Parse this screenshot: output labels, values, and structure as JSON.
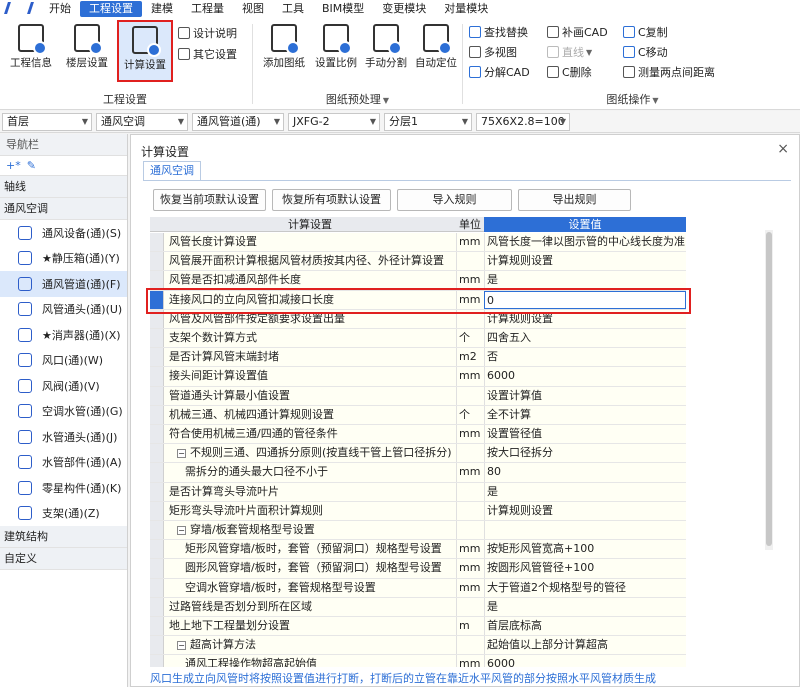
{
  "menu": {
    "items": [
      "开始",
      "工程设置",
      "建模",
      "工程量",
      "视图",
      "工具",
      "BIM模型",
      "变更模块",
      "对量模块"
    ],
    "active_index": 1
  },
  "ribbon": {
    "project_group": {
      "label": "工程设置",
      "btn_info": "工程信息",
      "btn_floor": "楼层设置",
      "btn_calc": "计算设置",
      "btn_design": "设计说明",
      "btn_other": "其它设置"
    },
    "drawing_group": {
      "label": "图纸预处理",
      "btn_add": "添加图纸",
      "btn_scale": "设置比例",
      "btn_split": "手动分割",
      "btn_locate": "自动定位"
    },
    "ops_group": {
      "label": "图纸操作",
      "btn_find": "查找替换",
      "btn_multi": "多视图",
      "btn_explode": "分解CAD",
      "btn_redraw": "补画CAD",
      "btn_line": "直线",
      "btn_cdel": "C删除",
      "btn_ccopy": "C复制",
      "btn_cmove": "C移动",
      "btn_measure": "测量两点间距离"
    }
  },
  "selects": {
    "floor": "首层",
    "discipline": "通风空调",
    "element": "通风管道(通)",
    "code": "JXFG-2",
    "layer": "分层1",
    "size": "75X6X2.8=100"
  },
  "nav": {
    "title": "导航栏",
    "categories": {
      "axis": "轴线",
      "hvac": "通风空调",
      "structure": "建筑结构",
      "custom": "自定义"
    },
    "items": [
      "通风设备(通)(S)",
      "★静压箱(通)(Y)",
      "通风管道(通)(F)",
      "风管通头(通)(U)",
      "★消声器(通)(X)",
      "风口(通)(W)",
      "风阀(通)(V)",
      "空调水管(通)(G)",
      "水管通头(通)(J)",
      "水管部件(通)(A)",
      "零星构件(通)(K)",
      "支架(通)(Z)"
    ],
    "selected_index": 2
  },
  "dialog": {
    "title": "计算设置",
    "close": "×",
    "tab": "通风空调",
    "btn_restore_current": "恢复当前项默认设置",
    "btn_restore_all": "恢复所有项默认设置",
    "btn_import": "导入规则",
    "btn_export": "导出规则",
    "grid_header": {
      "name": "计算设置",
      "unit": "单位",
      "value": "设置值"
    },
    "rows": [
      {
        "name": "风管长度计算设置",
        "unit": "mm",
        "value": "风管长度一律以图示管的中心线长度为准"
      },
      {
        "name": "风管展开面积计算根据风管材质按其内径、外径计算设置",
        "unit": "",
        "value": "计算规则设置"
      },
      {
        "name": "风管是否扣减通风部件长度",
        "unit": "mm",
        "value": "是"
      },
      {
        "name": "连接风口的立向风管扣减接口长度",
        "unit": "mm",
        "value": "0"
      },
      {
        "name": "风管及风管部件按定额要求设置出量",
        "unit": "",
        "value": "计算规则设置"
      },
      {
        "name": "支架个数计算方式",
        "unit": "个",
        "value": "四舍五入"
      },
      {
        "name": "是否计算风管末端封堵",
        "unit": "m2",
        "value": "否"
      },
      {
        "name": "接头间距计算设置值",
        "unit": "mm",
        "value": "6000"
      },
      {
        "name": "管道通头计算最小值设置",
        "unit": "",
        "value": "设置计算值"
      },
      {
        "name": "机械三通、机械四通计算规则设置",
        "unit": "个",
        "value": "全不计算"
      },
      {
        "name": "符合使用机械三通/四通的管径条件",
        "unit": "mm",
        "value": "设置管径值"
      },
      {
        "name": "不规则三通、四通拆分原则(按直线干管上管口径拆分)",
        "unit": "",
        "value": "按大口径拆分"
      },
      {
        "name": "需拆分的通头最大口径不小于",
        "unit": "mm",
        "value": "80"
      },
      {
        "name": "是否计算弯头导流叶片",
        "unit": "",
        "value": "是"
      },
      {
        "name": "矩形弯头导流叶片面积计算规则",
        "unit": "",
        "value": "计算规则设置"
      },
      {
        "name": "穿墙/板套管规格型号设置",
        "unit": "",
        "value": ""
      },
      {
        "name": "矩形风管穿墙/板时，套管（预留洞口）规格型号设置",
        "unit": "mm",
        "value": "按矩形风管宽高+100"
      },
      {
        "name": "圆形风管穿墙/板时，套管（预留洞口）规格型号设置",
        "unit": "mm",
        "value": "按圆形风管管径+100"
      },
      {
        "name": "空调水管穿墙/板时，套管规格型号设置",
        "unit": "mm",
        "value": "大于管道2个规格型号的管径"
      },
      {
        "name": "过路管线是否划分到所在区域",
        "unit": "",
        "value": "是"
      },
      {
        "name": "地上地下工程量划分设置",
        "unit": "m",
        "value": "首层底标高"
      },
      {
        "name": "超高计算方法",
        "unit": "",
        "value": "起始值以上部分计算超高"
      },
      {
        "name": "通风工程操作物超高起始值",
        "unit": "mm",
        "value": "6000"
      }
    ],
    "expander_minus": "−",
    "footer_note": "风口生成立向风管时将按照设置值进行打断，打断后的立管在靠近水平风管的部分按照水平风管材质生成"
  }
}
